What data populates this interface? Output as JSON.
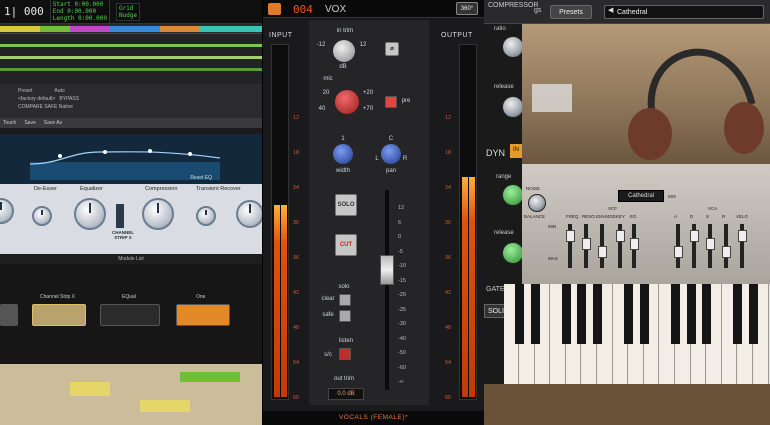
{
  "daw": {
    "counter": "1| 000",
    "transport_labels": [
      "Start",
      "End",
      "Length"
    ],
    "transport_values": [
      "0:00.000",
      "0:00.000",
      "0:00.000"
    ],
    "grid": "Grid",
    "nudge": "Nudge",
    "preset_row": [
      "Preset",
      "Auto"
    ],
    "preset_name": "<factory default>",
    "buttons": [
      "BYPASS",
      "COMPARE",
      "SAFE",
      "Native"
    ],
    "plugin_bar": [
      "Touch",
      "Save",
      "Save As"
    ],
    "eq_reset": "Reset EQ",
    "modules": [
      "De-Esser",
      "Equalizer",
      "Compression",
      "Transient Recover"
    ],
    "channel_logo": "CHANNEL STRIP X",
    "module_list": "Module List",
    "rack_slots": [
      "Channel Strip X",
      "EQual",
      "One"
    ]
  },
  "strip": {
    "preset_number": "004",
    "preset_name": "VOX",
    "view_button": "360°",
    "input_label": "INPUT",
    "output_label": "OUTPUT",
    "in_trim": "in trim",
    "mic": "mic",
    "pre": "pre",
    "width": "width",
    "pan": "pan",
    "solo_btn": "SOLO",
    "cut_btn": "CUT",
    "solo": "solo",
    "clear": "clear",
    "safe": "safe",
    "listen": "listen",
    "sc": "s/c",
    "out_trim": "out trim",
    "out_trim_value": "0.0 dB",
    "footer": "VOCALS (FEMALE)*",
    "phase_symbol": "⌀",
    "trim_ticks": [
      "0",
      "12",
      "-12"
    ],
    "trim_unit": "dB",
    "mic_ticks": [
      "20",
      "40",
      "+20",
      "+70",
      "0"
    ],
    "left_scale": [
      "12",
      "18",
      "24",
      "30",
      "36",
      "42",
      "48",
      "54",
      "60"
    ],
    "fader_scale": [
      "12",
      "6",
      "0",
      "-5",
      "-10",
      "-15",
      "-20",
      "-25",
      "-30",
      "-40",
      "-50",
      "-60",
      "-∞"
    ],
    "pan_ticks": [
      "L",
      "R",
      "C"
    ],
    "width_ticks": [
      "0",
      "1",
      "2"
    ],
    "in_meter_level": 0.55,
    "out_meter_level": 0.63
  },
  "right": {
    "compressor_label": "COMPRESSOR",
    "tab_frag": "gs",
    "presets_button": "Presets",
    "preset_value": "Cathedral",
    "ratio": "ratio",
    "release": "release",
    "range": "range",
    "release2": "release",
    "dyn": "DYN",
    "in_btn": "IN",
    "gate": "GATE /",
    "solid": "SOLID",
    "synth_display": "Cathedral",
    "synth_labels": [
      "NOISE",
      "BALANCE",
      "VCF",
      "FREQ",
      "RESO",
      "ENVMOD",
      "KEY",
      "EG",
      "MIX",
      "VCA",
      "A",
      "D",
      "S",
      "R",
      "VELO"
    ],
    "min_max": [
      "MIN",
      "MAX"
    ]
  },
  "colors": {
    "accent": "#f3531d",
    "meter": "#e0520f",
    "red_button": "#d0312d"
  }
}
